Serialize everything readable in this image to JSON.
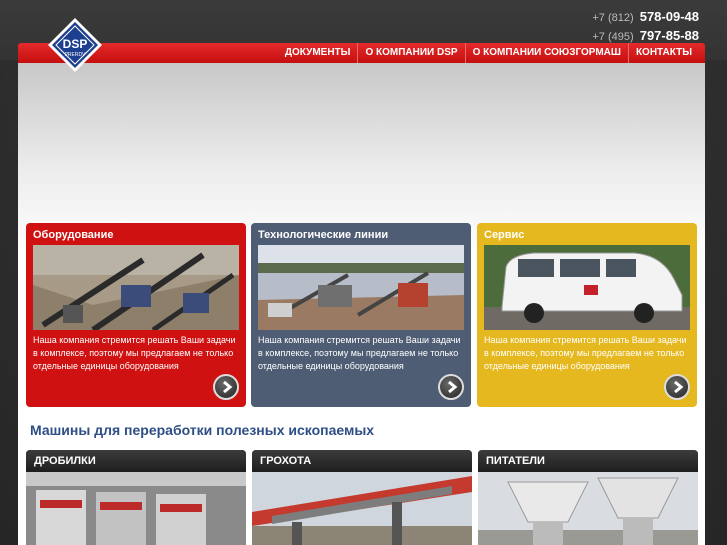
{
  "header": {
    "logo": {
      "text_main": "DSP",
      "text_sub": "PRERDV"
    },
    "phones": [
      {
        "code": "+7 (812)",
        "number": "578-09-48"
      },
      {
        "code": "+7 (495)",
        "number": "797-85-88"
      }
    ]
  },
  "nav": {
    "items": [
      {
        "label": "ДОКУМЕНТЫ"
      },
      {
        "label": "О КОМПАНИИ DSP"
      },
      {
        "label": "О КОМПАНИИ СОЮЗГОРМАШ"
      },
      {
        "label": "КОНТАКТЫ"
      }
    ]
  },
  "features": [
    {
      "title": "Оборудование",
      "text": "Наша компания стремится решать Ваши задачи в комплексе, поэтому мы предлагаем не только отдельные единицы оборудования",
      "color": "#cf1111",
      "icon": "arrow-right-icon"
    },
    {
      "title": "Технологические линии",
      "text": "Наша компания стремится решать Ваши задачи в комплексе, поэтому мы предлагаем не только отдельные единицы оборудования",
      "color": "#4f5d74",
      "icon": "arrow-right-icon"
    },
    {
      "title": "Сервис",
      "text": "Наша компания стремится решать Ваши задачи в комплексе, поэтому мы предлагаем не только отдельные единицы оборудования",
      "color": "#e6b81f",
      "icon": "arrow-right-icon"
    }
  ],
  "machines": {
    "title": "Машины для переработки полезных ископаемых",
    "categories": [
      {
        "label": "ДРОБИЛКИ"
      },
      {
        "label": "ГРОХОТА"
      },
      {
        "label": "ПИТАТЕЛИ"
      }
    ]
  }
}
